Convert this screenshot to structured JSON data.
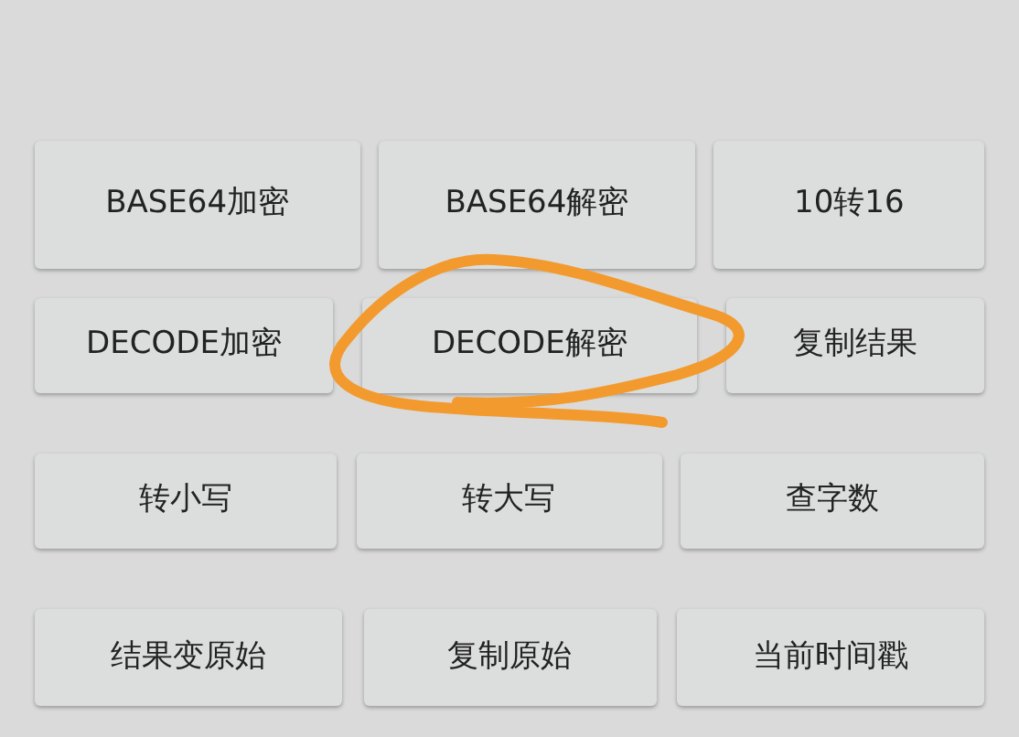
{
  "rows": [
    [
      "BASE64加密",
      "BASE64解密",
      "10转16"
    ],
    [
      "DECODE加密",
      "DECODE解密",
      "复制结果"
    ],
    [
      "转小写",
      "转大写",
      "查字数"
    ],
    [
      "结果变原始",
      "复制原始",
      "当前时间戳"
    ]
  ]
}
